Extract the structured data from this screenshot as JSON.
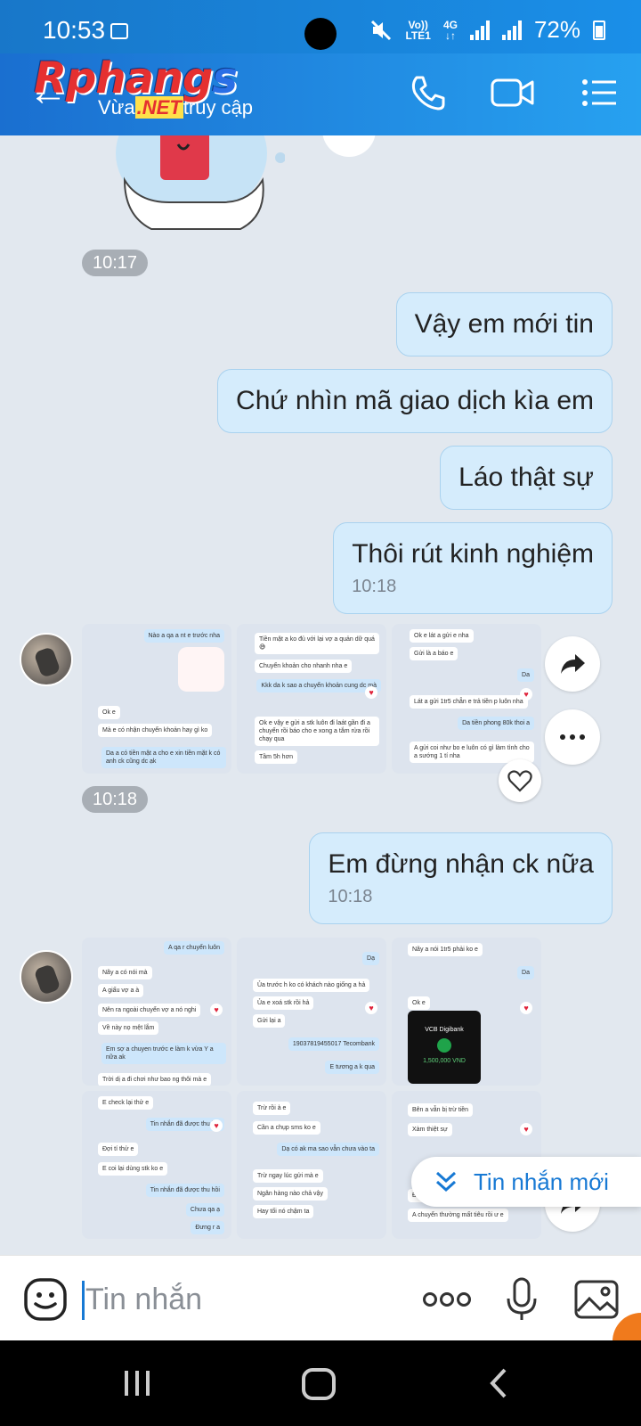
{
  "status_bar": {
    "time": "10:53",
    "network_top": "Vo))",
    "network_bottom": "LTE1",
    "data_top": "4G",
    "battery": "72%"
  },
  "header": {
    "logo_part1": "Rphang",
    "logo_part2": "s",
    "tagline_before": "Vừa",
    "tagline_net": ".NET",
    "tagline_after": "truy cập"
  },
  "messages": {
    "time1": "10:17",
    "m1": "Vậy em mới tin",
    "m2": "Chứ nhìn mã giao dịch kìa em",
    "m3": "Láo thật sự",
    "m4": "Thôi rút kinh nghiệm",
    "m4_time": "10:18",
    "time2": "10:18",
    "m5": "Em đừng nhận ck nữa",
    "m5_time": "10:18"
  },
  "shots1": {
    "a1": "Nào a qa a nt e trước nha",
    "a2": "Ok e",
    "a3": "Mà e có nhận chuyển khoản hay gì ko",
    "a4": "Da a có tiền mặt a cho e xin tiền mặt k có anh ck cũng dc ạk",
    "b1": "Tiền mặt a ko đủ với lại vợ a quản dữ quá 😅",
    "b2": "Chuyển khoản cho nhanh nha e",
    "b3": "Kkk da k sao a chuyển khoản cung dc mà",
    "b4": "Ok e vậy e gửi a stk luôn đi laát gần đi a chuyển rồi báo cho e xong a tắm rửa rồi chạy qua",
    "b5": "Tầm 5h hơn",
    "c1": "Ok e lát a gửi e nha",
    "c2": "Gửi là a báo e",
    "c3": "Da",
    "c4": "Lát a gửi 1tr5 chẵn e trả tiền p luôn nha",
    "c5": "Da tiền phong 80k thoi a",
    "c6": "A gửi coi như bo e luôn có gì làm tình cho a sướng 1 tí nha"
  },
  "shots2": {
    "d1": "A qa r chuyển luôn",
    "d2": "Nãy a có nói mà",
    "d3": "A giấu vợ a à",
    "d4": "Nên ra ngoài chuyển vợ a nó nghi",
    "d5": "Về này nọ mệt lắm",
    "d6": "Em sợ a chuyen trước e làm k vừa Y a nữa ak",
    "d7": "Trời dị a đi chơi như bao ng thôi mà e",
    "e1": "Dạ",
    "e2": "Ủa trước h ko có khách nào giống a hả",
    "e3": "Ủa e xoá stk rồi hả",
    "e4": "Gửi lại a",
    "e5": "19037819455017 Tecombank",
    "e6": "E tương a k qua",
    "f1": "Nãy a nói 1tr5 phải ko e",
    "f2": "Da",
    "f3": "Ok e",
    "f4": "VCB Digibank",
    "f5": "1,500,000 VND",
    "g1": "E check lại thử e",
    "g2": "Tin nhắn đã được thu hồi",
    "g3": "Đợi tí thử e",
    "g4": "E coi lại dùng stk ko e",
    "g5": "Tin nhắn đã được thu hồi",
    "g6": "Chưa qa ạ",
    "g7": "Đưng r a",
    "h1": "Trừ rồi à e",
    "h2": "Cần a chụp sms ko e",
    "h3": "Dạ có ak ma sao vẫn chưa vào ta",
    "h4": "Trừ ngay lúc gửi mà e",
    "h5": "Ngân hàng nào chả vậy",
    "h6": "Hay tối nó chậm ta",
    "i1": "Bên a vẫn bị trừ tiền",
    "i2": "Xàm thiệt sự",
    "i3": "Để a coi",
    "i4": "A chuyển thường mất tiêu rồi ư e"
  },
  "new_message": "Tin nhắn mới",
  "input": {
    "placeholder": "Tin nhắn"
  },
  "colors": {
    "header_start": "#1a6fd0",
    "header_end": "#27a1f0",
    "bubble": "#d5ecfc",
    "chat_bg": "#e2e8ef",
    "accent": "#1779d4"
  }
}
